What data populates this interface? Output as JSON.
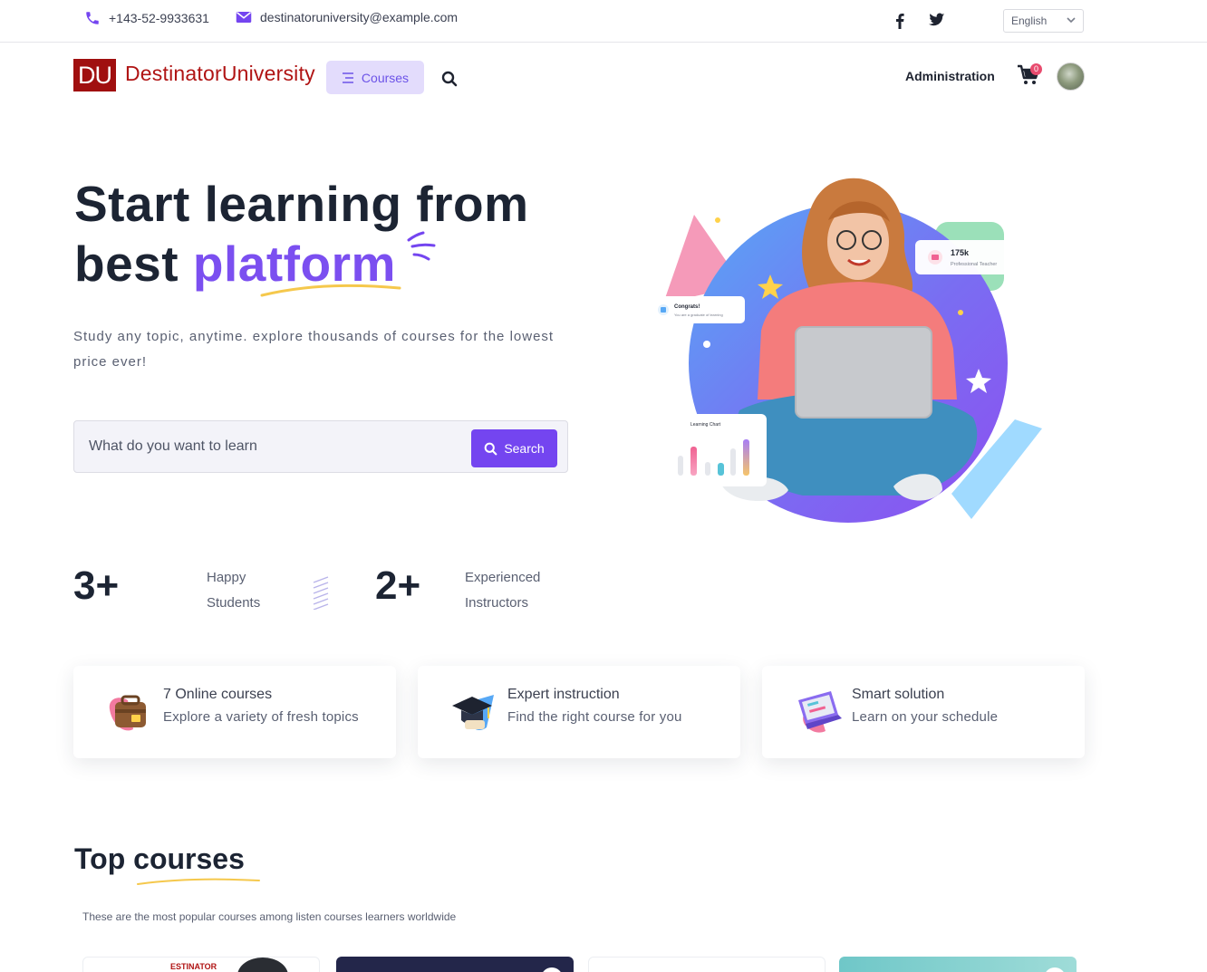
{
  "topbar": {
    "phone": "+143-52-9933631",
    "email": "destinatoruniversity@example.com",
    "social_icons": [
      "facebook-icon",
      "twitter-icon"
    ],
    "language": "English"
  },
  "nav": {
    "logo_initials": "DU",
    "logo_name": "DestinatorUniversity",
    "courses_label": "Courses",
    "admin_label": "Administration",
    "cart_count": "0"
  },
  "hero": {
    "title_line1": "Start learning from",
    "title_line2_plain": "best",
    "title_line2_accent": "platform",
    "subtitle": "Study any topic, anytime. explore thousands of courses for the lowest price ever!",
    "search_placeholder": "What do you want to learn",
    "search_button": "Search",
    "badge_congrats": "Congrats!",
    "badge_congrats_sub": "You are a graduate of learning",
    "badge_teachers": "175k",
    "badge_teachers_sub": "Professional Teacher",
    "chart_card_title": "Learning Chart"
  },
  "stats": [
    {
      "value": "3+",
      "label_line1": "Happy",
      "label_line2": "Students"
    },
    {
      "value": "2+",
      "label_line1": "Experienced",
      "label_line2": "Instructors"
    }
  ],
  "features": [
    {
      "title": "7 Online courses",
      "desc": "Explore a variety of fresh topics",
      "icon": "bag-icon"
    },
    {
      "title": "Expert instruction",
      "desc": "Find the right course for you",
      "icon": "graduation-cap-icon"
    },
    {
      "title": "Smart solution",
      "desc": "Learn on your schedule",
      "icon": "laptop-icon"
    }
  ],
  "top_courses": {
    "title": "Top courses",
    "subtitle": "These are the most popular courses among listen courses learners worldwide",
    "first_thumb_label": "ESTINATOR"
  },
  "colors": {
    "accent": "#7445f0",
    "brand_red": "#a00f0f",
    "courses_btn_bg": "#e3dcfc"
  }
}
